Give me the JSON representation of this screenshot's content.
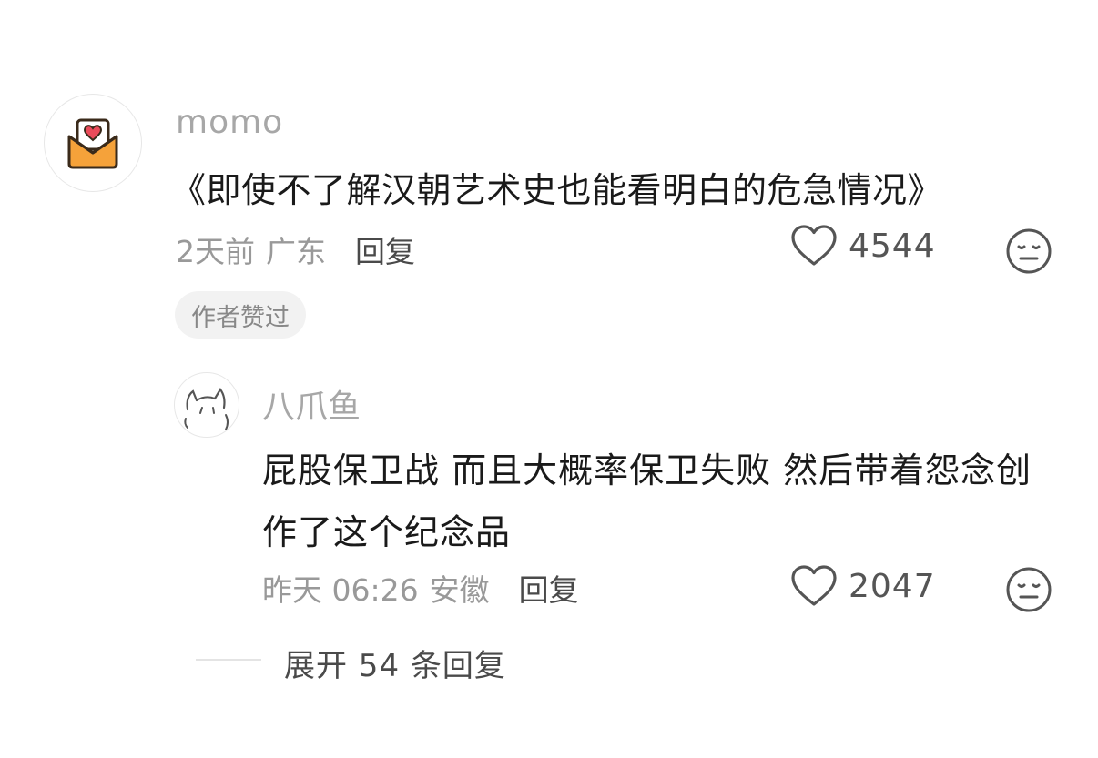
{
  "comment": {
    "username": "momo",
    "content": "《即使不了解汉朝艺术史也能看明白的危急情况》",
    "time": "2天前",
    "location": "广东",
    "reply_label": "回复",
    "likes": "4544",
    "author_badge": "作者赞过",
    "avatar_icon": "envelope-heart-icon"
  },
  "reply": {
    "username": "八爪鱼",
    "content": "屁股保卫战 而且大概率保卫失败 然后带着怨念创作了这个纪念品",
    "time": "昨天 06:26",
    "location": "安徽",
    "reply_label": "回复",
    "likes": "2047",
    "avatar_icon": "cat-sketch-icon"
  },
  "expand": {
    "label": "展开 54 条回复"
  },
  "colors": {
    "accent_orange": "#f5a23a",
    "heart_red": "#ea4b5a"
  }
}
